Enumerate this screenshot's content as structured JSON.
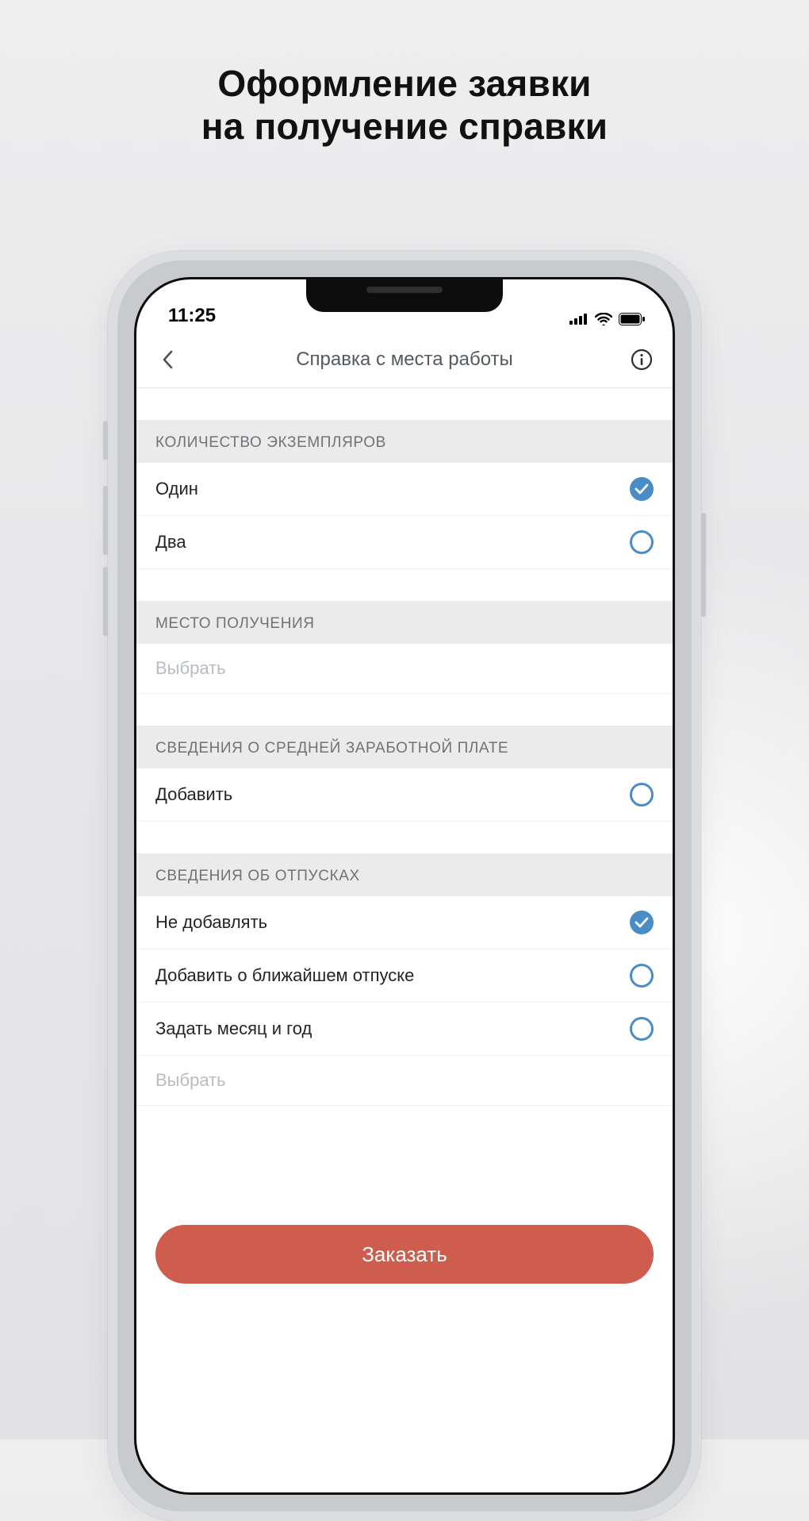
{
  "promo": {
    "line1": "Оформление заявки",
    "line2": "на получение справки"
  },
  "status": {
    "time": "11:25"
  },
  "navbar": {
    "title": "Справка с места работы"
  },
  "sections": {
    "copies": {
      "header": "КОЛИЧЕСТВО ЭКЗЕМПЛЯРОВ",
      "options": [
        "Один",
        "Два"
      ]
    },
    "pickup": {
      "header": "МЕСТО ПОЛУЧЕНИЯ",
      "placeholder": "Выбрать"
    },
    "salary": {
      "header": "СВЕДЕНИЯ О СРЕДНЕЙ ЗАРАБОТНОЙ ПЛАТЕ",
      "option": "Добавить"
    },
    "vacation": {
      "header": "СВЕДЕНИЯ ОБ ОТПУСКАХ",
      "options": [
        "Не добавлять",
        "Добавить о ближайшем отпуске",
        "Задать месяц и год"
      ],
      "placeholder": "Выбрать"
    }
  },
  "cta": {
    "order": "Заказать"
  }
}
